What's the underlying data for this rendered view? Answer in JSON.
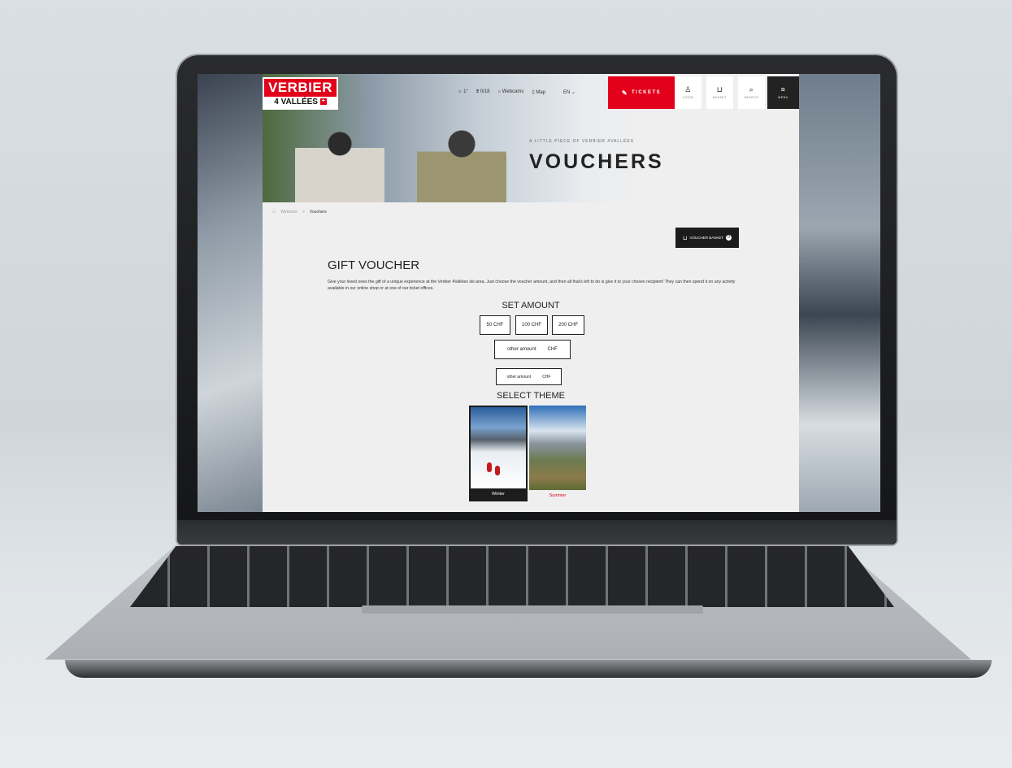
{
  "site": {
    "logo_top": "VERBIER",
    "logo_bottom": "4 VALLÉES"
  },
  "nav": {
    "weather": "1°",
    "lifts": "0/18",
    "webcams": "Webcams",
    "map": "Map",
    "language": "EN",
    "tickets": "TICKETS",
    "login": "LOGIN",
    "basket": "BASKET",
    "search": "SEARCH",
    "menu": "MENU"
  },
  "hero": {
    "kicker": "A LITTLE PIECE OF VERBIER 4VALLÉES",
    "title": "VOUCHERS"
  },
  "breadcrumb": {
    "home": "Welcome",
    "separator": ">",
    "current": "Vouchers"
  },
  "voucher_basket": {
    "label": "VOUCHER BASKET",
    "count": "0"
  },
  "gift": {
    "title": "GIFT VOUCHER",
    "description": "Give your loved ones the gift of a unique experience at the Verbier 4Vallées ski area. Just choose the voucher amount, and then all that's left to do is give it to your chosen recipient! They can then spend it on any activity available in our online shop or at one of our ticket offices."
  },
  "amount": {
    "title": "SET AMOUNT",
    "options": [
      "50 CHF",
      "100 CHF",
      "200 CHF"
    ],
    "other_placeholder": "other amount",
    "currency": "CHF"
  },
  "theme": {
    "title": "SELECT THEME",
    "options": [
      "Winter",
      "Summer"
    ]
  },
  "colors": {
    "brand_red": "#e2001a",
    "dark": "#1c1c1c"
  }
}
